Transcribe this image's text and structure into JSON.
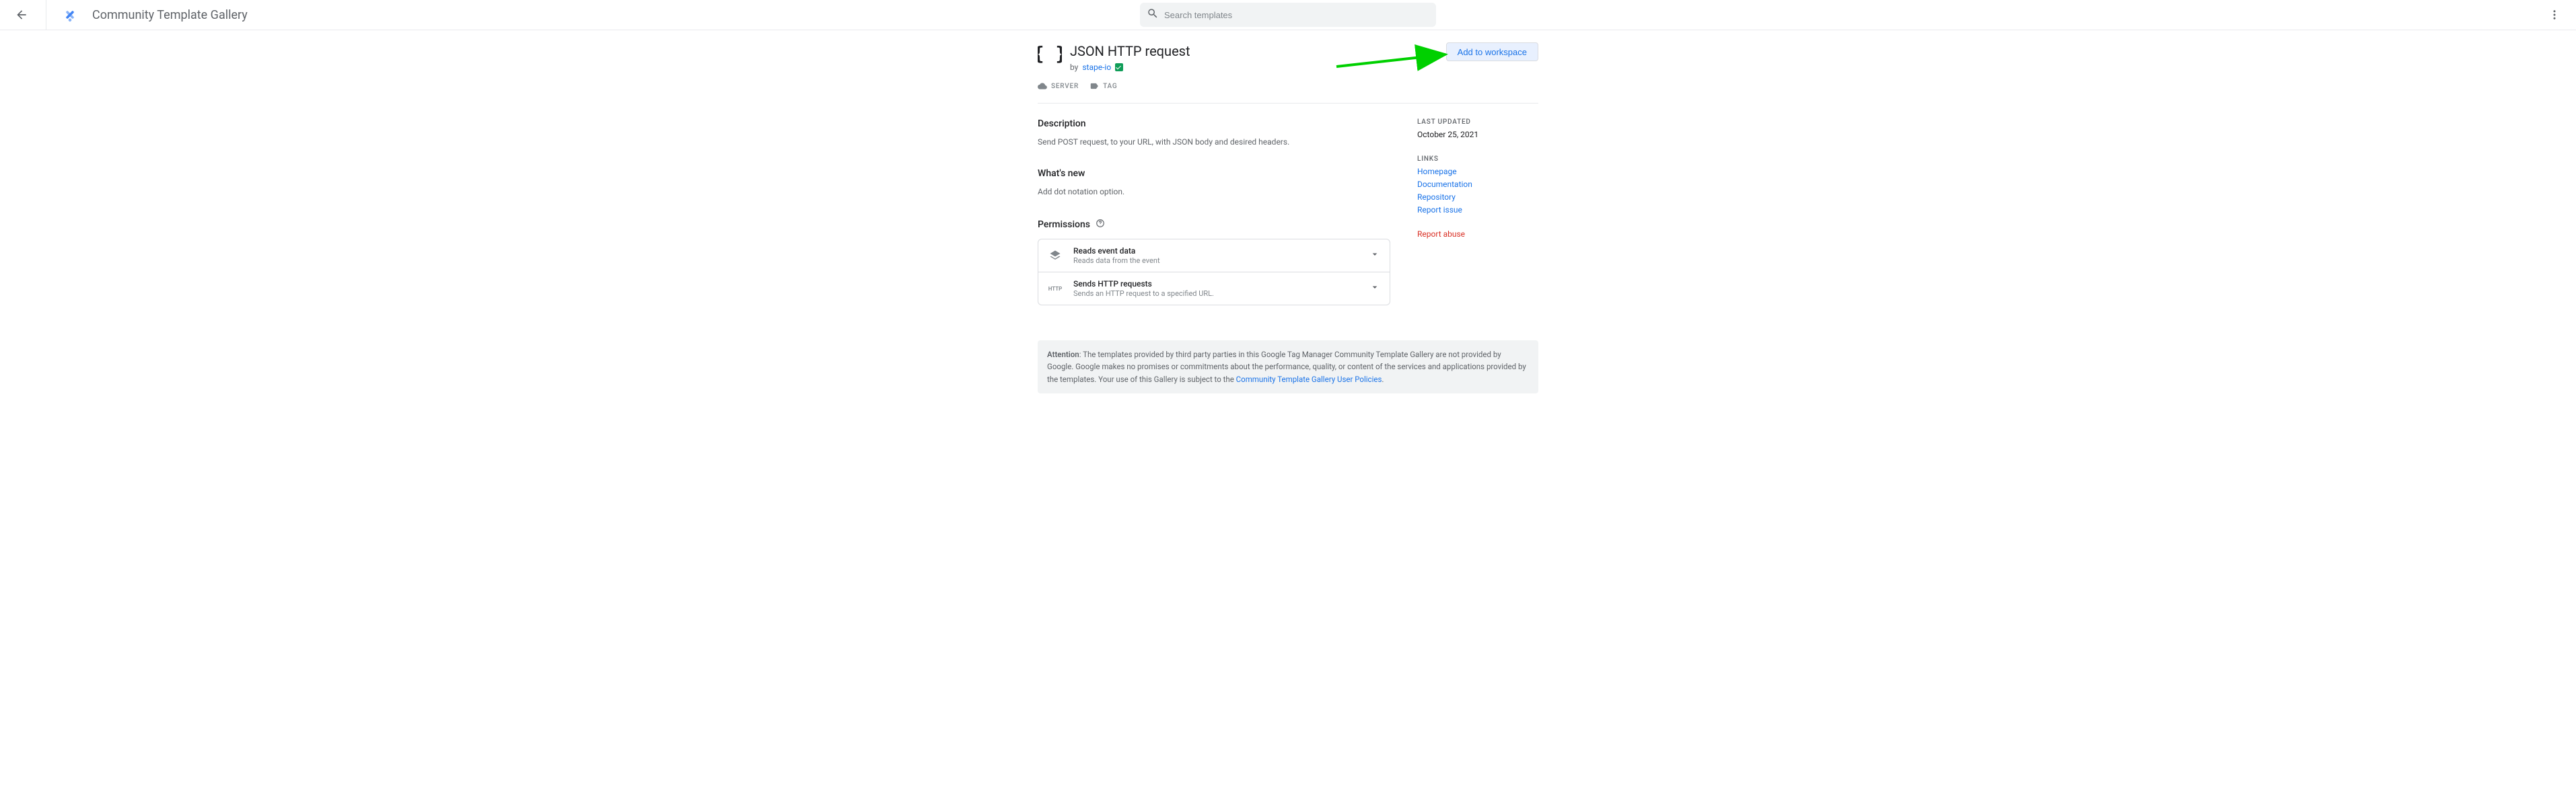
{
  "header": {
    "title": "Community Template Gallery",
    "search_placeholder": "Search templates"
  },
  "template": {
    "title": "JSON HTTP request",
    "by_prefix": "by",
    "author": "stape-io",
    "add_button": "Add to workspace",
    "meta": {
      "platform": "SERVER",
      "type": "TAG"
    }
  },
  "sections": {
    "description": {
      "heading": "Description",
      "body": "Send POST request, to your URL, with JSON body and desired headers."
    },
    "whatsnew": {
      "heading": "What's new",
      "body": "Add dot notation option."
    },
    "permissions": {
      "heading": "Permissions",
      "items": [
        {
          "title": "Reads event data",
          "subtitle": "Reads data from the event"
        },
        {
          "title": "Sends HTTP requests",
          "subtitle": "Sends an HTTP request to a specified URL."
        }
      ]
    }
  },
  "sidebar": {
    "last_updated_label": "LAST UPDATED",
    "last_updated_value": "October 25, 2021",
    "links_label": "LINKS",
    "links": [
      {
        "label": "Homepage"
      },
      {
        "label": "Documentation"
      },
      {
        "label": "Repository"
      },
      {
        "label": "Report issue"
      }
    ],
    "report_abuse": "Report abuse"
  },
  "notice": {
    "strong": "Attention",
    "body": ": The templates provided by third party parties in this Google Tag Manager Community Template Gallery are not provided by Google. Google makes no promises or commitments about the performance, quality, or content of the services and applications provided by the templates. Your use of this Gallery is subject to the ",
    "link": "Community Template Gallery User Policies",
    "tail": "."
  }
}
